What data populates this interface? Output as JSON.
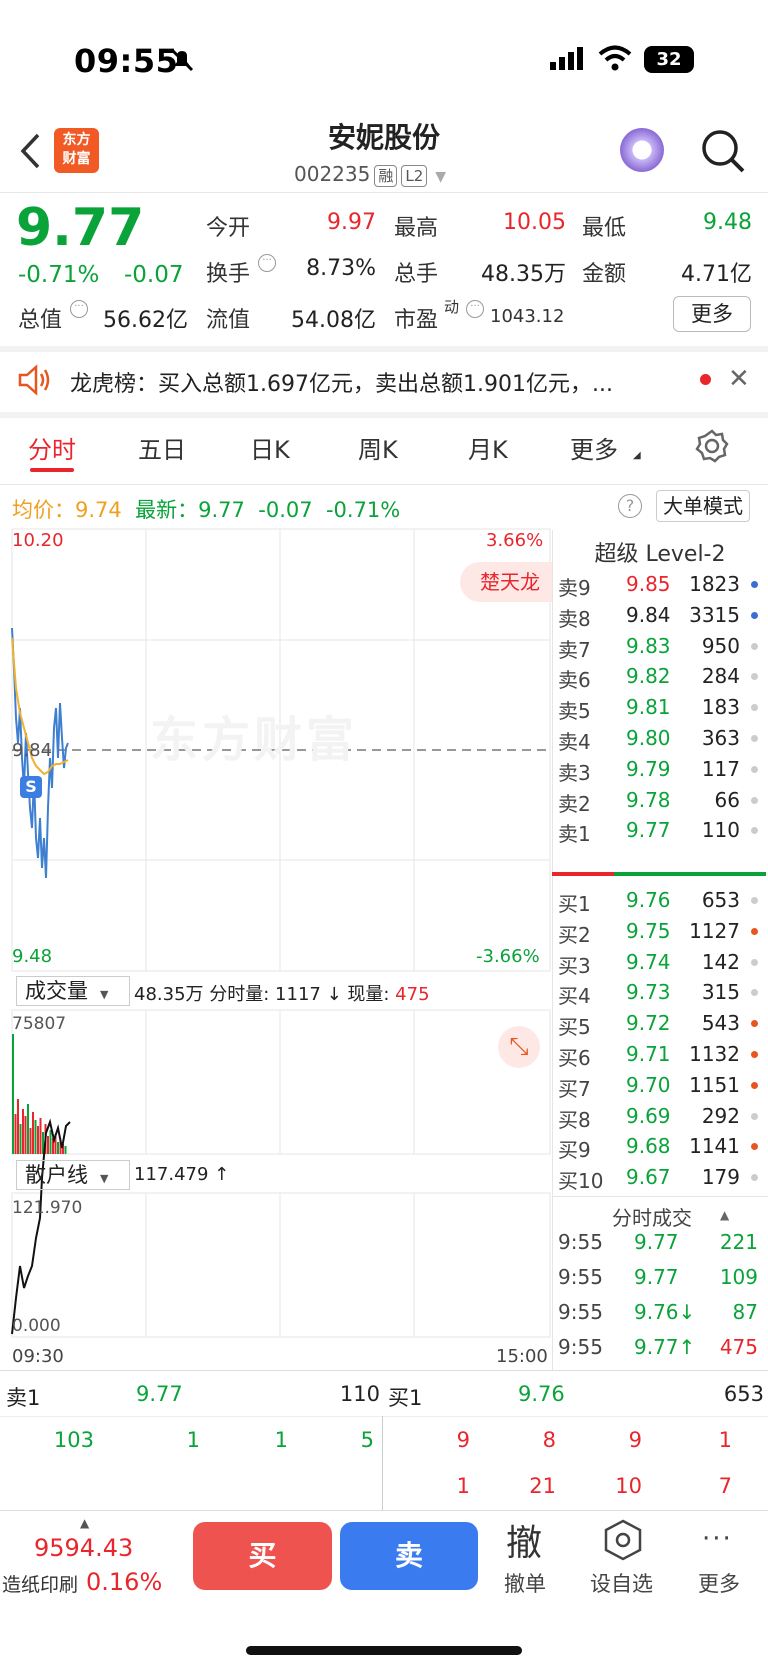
{
  "status": {
    "time": "09:55",
    "battery": "32"
  },
  "header": {
    "name": "安妮股份",
    "code": "002235",
    "tag1": "融",
    "tag2": "L2",
    "logo_text": "东方\n财富"
  },
  "quote": {
    "price": "9.77",
    "change_pct": "-0.71%",
    "change": "-0.07",
    "open_label": "今开",
    "open": "9.97",
    "high_label": "最高",
    "high": "10.05",
    "low_label": "最低",
    "low": "9.48",
    "turnover_label": "换手",
    "turnover": "8.73%",
    "vol_label": "总手",
    "volume": "48.35万",
    "amount_label": "金额",
    "amount": "4.71亿",
    "mcap_label": "总值",
    "mcap": "56.62亿",
    "float_label": "流值",
    "float_cap": "54.08亿",
    "pe_label": "市盈",
    "pe_sup": "动",
    "pe": "1043.12",
    "more": "更多"
  },
  "banner": {
    "text": "龙虎榜：买入总额1.697亿元，卖出总额1.901亿元，..."
  },
  "tabs": [
    "分时",
    "五日",
    "日K",
    "周K",
    "月K",
    "更多"
  ],
  "info": {
    "avg_label": "均价：",
    "avg": "9.74",
    "latest_label": "最新：",
    "latest": "9.77",
    "chg": "-0.07",
    "pct": "-0.71%",
    "mode_btn": "大单模式"
  },
  "chart": {
    "ymax": "10.20",
    "ymin": "9.48",
    "pmax": "3.66%",
    "pmin": "-3.66%",
    "mid": "9.84",
    "tag": "楚天龙",
    "watermark": "东方财富",
    "s_marker": "S",
    "vol_label": "成交量",
    "vol_info_a": "48.35万 分时量: 1117 ↓ 现量: ",
    "vol_info_b": "475",
    "vol_max": "75807",
    "retail_label": "散户线",
    "retail_val": "117.479 ↑",
    "retail_max": "121.970",
    "retail_min": "0.000",
    "t_start": "09:30",
    "t_end": "15:00"
  },
  "chart_data": {
    "type": "line",
    "title": "",
    "x": [
      "09:30",
      "15:00"
    ],
    "ylim": [
      9.48,
      10.2
    ],
    "ref": 9.84
  },
  "orderbook": {
    "title": "超级 Level-2",
    "asks": [
      [
        "卖9",
        "9.85",
        "1823",
        "#3b6fd6",
        "red"
      ],
      [
        "卖8",
        "9.84",
        "3315",
        "#3b6fd6",
        "black"
      ],
      [
        "卖7",
        "9.83",
        "950",
        "#ccc",
        "green"
      ],
      [
        "卖6",
        "9.82",
        "284",
        "#ccc",
        "green"
      ],
      [
        "卖5",
        "9.81",
        "183",
        "#ccc",
        "green"
      ],
      [
        "卖4",
        "9.80",
        "363",
        "#ccc",
        "green"
      ],
      [
        "卖3",
        "9.79",
        "117",
        "#ccc",
        "green"
      ],
      [
        "卖2",
        "9.78",
        "66",
        "#ccc",
        "green"
      ],
      [
        "卖1",
        "9.77",
        "110",
        "#ccc",
        "green"
      ]
    ],
    "bids": [
      [
        "买1",
        "9.76",
        "653",
        "#ccc",
        "green"
      ],
      [
        "买2",
        "9.75",
        "1127",
        "#e8561f",
        "green"
      ],
      [
        "买3",
        "9.74",
        "142",
        "#ccc",
        "green"
      ],
      [
        "买4",
        "9.73",
        "315",
        "#ccc",
        "green"
      ],
      [
        "买5",
        "9.72",
        "543",
        "#e8561f",
        "green"
      ],
      [
        "买6",
        "9.71",
        "1132",
        "#e8561f",
        "green"
      ],
      [
        "买7",
        "9.70",
        "1151",
        "#e8561f",
        "green"
      ],
      [
        "买8",
        "9.69",
        "292",
        "#ccc",
        "green"
      ],
      [
        "买9",
        "9.68",
        "1141",
        "#e8561f",
        "green"
      ],
      [
        "买10",
        "9.67",
        "179",
        "#ccc",
        "green"
      ]
    ]
  },
  "trades": {
    "title": "分时成交",
    "rows": [
      [
        "9:55",
        "9.77",
        "221",
        "",
        ""
      ],
      [
        "9:55",
        "9.77",
        "109",
        "",
        ""
      ],
      [
        "9:55",
        "9.76↓",
        "87",
        "green",
        ""
      ],
      [
        "9:55",
        "9.77↑",
        "475",
        "red",
        "up"
      ]
    ]
  },
  "queue": {
    "sell_label": "卖1",
    "sell_price": "9.77",
    "sell_vol": "110",
    "buy_label": "买1",
    "buy_price": "9.76",
    "buy_vol": "653",
    "sell_q": [
      "103",
      "1",
      "1",
      "5"
    ],
    "buy_q1": [
      "9",
      "8",
      "9",
      "1"
    ],
    "buy_q2": [
      "1",
      "21",
      "10",
      "7"
    ]
  },
  "footer": {
    "index": "9594.43",
    "index_name": "造纸印刷",
    "index_pct": "0.16%",
    "buy": "买",
    "sell": "卖",
    "cancel_glyph": "撤",
    "cancel": "撤单",
    "watch": "设自选",
    "more": "更多"
  }
}
